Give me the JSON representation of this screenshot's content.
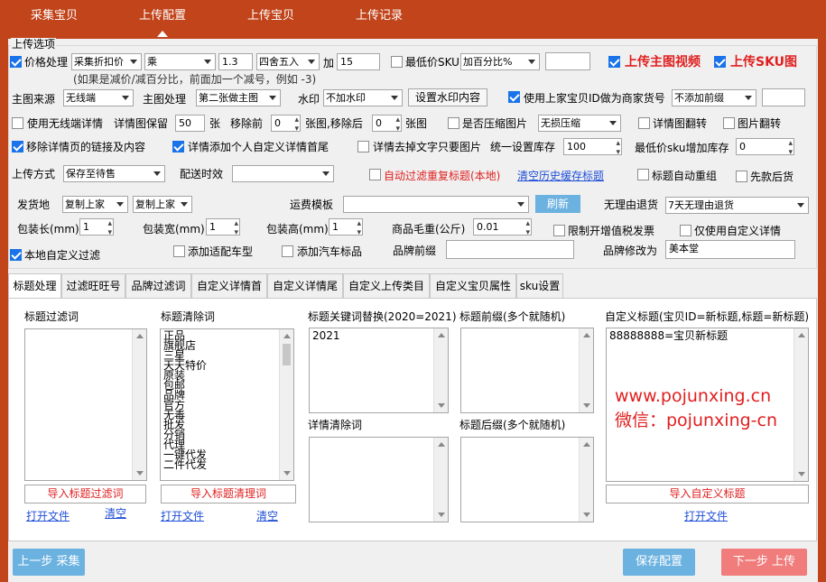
{
  "nav": {
    "tabs": [
      "采集宝贝",
      "上传配置",
      "上传宝贝",
      "上传记录"
    ]
  },
  "group_title": "上传选项",
  "row1": {
    "price_label": "价格处理",
    "price_mode": "采集折扣价",
    "operator": "乘",
    "factor": "1.3",
    "rounding": "四舍五入",
    "add_label": "加",
    "add_value": "15",
    "min_sku_label": "最低价SKU",
    "min_sku_mode": "加百分比%",
    "min_sku_value": "",
    "upload_video": "上传主图视频",
    "upload_sku_img": "上传SKU图"
  },
  "hint": "(如果是减价/减百分比，前面加一个减号，例如 -3)",
  "row2": {
    "main_src_label": "主图来源",
    "main_src": "无线端",
    "main_proc_label": "主图处理",
    "main_proc": "第二张做主图",
    "watermark_label": "水印",
    "watermark": "不加水印",
    "watermark_btn": "设置水印内容",
    "use_prev_id": "使用上家宝贝ID做为商家货号",
    "prefix": "不添加前缀",
    "prefix_value": ""
  },
  "row3": {
    "use_wireless": "使用无线端详情",
    "detail_keep": "详情图保留",
    "detail_keep_val": "50",
    "unit": "张",
    "remove_first": "移除前",
    "remove_first_val": "0",
    "remove_after_txt": "张图,移除后",
    "remove_after_val": "0",
    "remove_after_unit": "张图",
    "compress": "是否压缩图片",
    "compress_mode": "无损压缩",
    "flip_detail": "详情图翻转",
    "flip_img": "图片翻转"
  },
  "row4": {
    "remove_links": "移除详情页的链接及内容",
    "add_custom": "详情添加个人自定义详情首尾",
    "remove_text_imgs": "详情去掉文字只要图片",
    "stock_label": "统一设置库存",
    "stock_val": "100",
    "min_sku_stock": "最低价sku增加库存",
    "min_sku_stock_val": "0"
  },
  "row5": {
    "upload_mode_label": "上传方式",
    "upload_mode": "保存至待售",
    "delivery_label": "配送时效",
    "delivery": "",
    "auto_filter": "自动过滤重复标题(本地)",
    "clear_history": "清空历史缓存标题",
    "title_regroup": "标题自动重组",
    "presale": "先款后货"
  },
  "row6": {
    "ship_label": "发货地",
    "ship1": "复制上家",
    "ship2": "复制上家",
    "freight_label": "运费模板",
    "freight": "",
    "refresh_btn": "刷新",
    "return_label": "无理由退货",
    "return_val": "7天无理由退货"
  },
  "row7": {
    "len_label": "包装长(mm)",
    "len_val": "1",
    "wid_label": "包装宽(mm)",
    "wid_val": "1",
    "hei_label": "包装高(mm)",
    "hei_val": "1",
    "weight_label": "商品毛重(公斤)",
    "weight_val": "0.01",
    "limit_invoice": "限制开增值税发票",
    "only_custom": "仅使用自定义详情"
  },
  "row8": {
    "local_filter": "本地自定义过滤",
    "add_car": "添加适配车型",
    "add_auto_mark": "添加汽车标品",
    "brand_prefix_label": "品牌前缀",
    "brand_prefix_val": "",
    "brand_rename_label": "品牌修改为",
    "brand_rename_val": "美本堂"
  },
  "tabs": [
    "标题处理",
    "过滤旺旺号",
    "品牌过滤词",
    "自定义详情首",
    "自定义详情尾",
    "自定义上传类目",
    "自定义宝贝属性",
    "sku设置"
  ],
  "panel": {
    "filter_title": "标题过滤词",
    "clear_title": "标题清除词",
    "clear_words": [
      "正品",
      "旗舰店",
      "三星",
      "天天特价",
      "原装",
      "包邮",
      "品牌",
      "官方",
      "无毒",
      "批发",
      "分销",
      "代理",
      "一键代发",
      "二件代发"
    ],
    "replace_title": "标题关键词替换(2020=2021)",
    "replace_value": "2021",
    "prefix_title": "标题前缀(多个就随机)",
    "custom_title": "自定义标题(宝贝ID=新标题,标题=新标题)",
    "custom_value": "88888888=宝贝新标题",
    "detail_clear_title": "详情清除词",
    "suffix_title": "标题后缀(多个就随机)",
    "import_filter": "导入标题过滤词",
    "import_clear": "导入标题清理词",
    "import_custom": "导入自定义标题",
    "open_file": "打开文件",
    "clear": "清空",
    "watermark1": "www.pojunxing.cn",
    "watermark2": "微信：pojunxing-cn"
  },
  "bottom": {
    "prev": "上一步 采集",
    "save": "保存配置",
    "next": "下一步 上传"
  },
  "colors": {
    "brand": "#c1441b",
    "link": "#1f4fd6",
    "danger": "#e02020",
    "btn_blue": "#6cb2e0",
    "btn_red": "#f07c7c"
  }
}
